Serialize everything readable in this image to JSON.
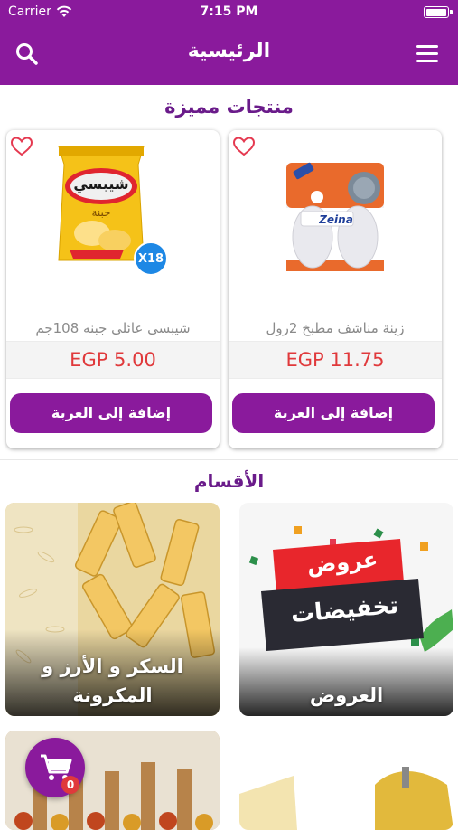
{
  "status_bar": {
    "carrier": "Carrier",
    "time": "7:15 PM"
  },
  "nav": {
    "title": "الرئيسية"
  },
  "featured": {
    "title": "منتجات مميزة",
    "products": [
      {
        "name": "زينة مناشف مطبخ 2رول",
        "price": "EGP 11.75",
        "add_label": "إضافة إلى العربة",
        "package_brand": "Zeina"
      },
      {
        "name": "شيبسى عائلى جبنه 108جم",
        "price": "EGP 5.00",
        "add_label": "إضافة إلى العربة",
        "package_brand": "شيبسي",
        "package_flavor": "جبنة",
        "multiplier_badge": "X18"
      }
    ]
  },
  "categories": {
    "title": "الأقسام",
    "items": [
      {
        "label": "العروض",
        "banner_line1": "عروض",
        "banner_line2": "تخفيضات"
      },
      {
        "label_line1": "السكر و الأرز و",
        "label_line2": "المكرونة"
      }
    ]
  },
  "cart": {
    "count": "0"
  },
  "colors": {
    "primary": "#8a1a9c",
    "price": "#e0393b",
    "heading": "#6a1b8a",
    "badge": "#1e88e5"
  }
}
